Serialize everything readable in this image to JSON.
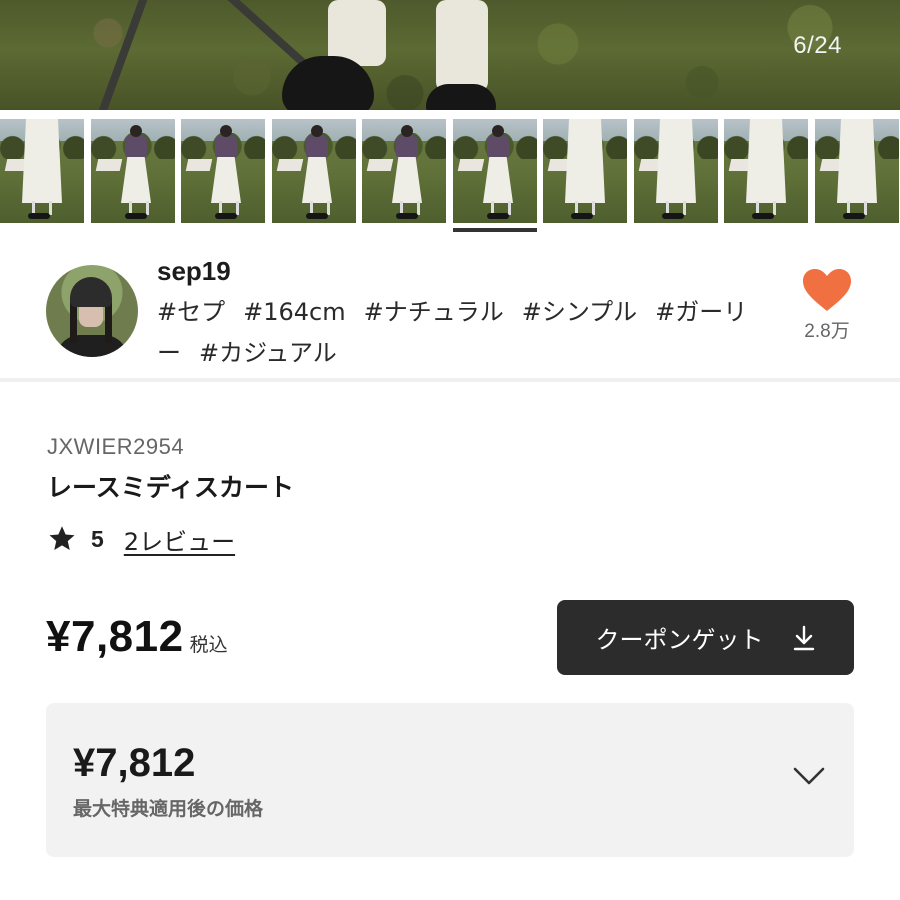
{
  "hero": {
    "image_counter": "6/24",
    "description_icon": "photo"
  },
  "thumbnails": {
    "count_visible": 10,
    "selected_index": 5,
    "items": [
      {
        "kind": "close"
      },
      {
        "kind": "full"
      },
      {
        "kind": "full"
      },
      {
        "kind": "full"
      },
      {
        "kind": "full"
      },
      {
        "kind": "full"
      },
      {
        "kind": "close"
      },
      {
        "kind": "close"
      },
      {
        "kind": "close"
      },
      {
        "kind": "close"
      }
    ]
  },
  "author": {
    "username": "sep19",
    "tags": [
      "#セプ",
      "#164cm",
      "#ナチュラル",
      "#シンプル",
      "#ガーリー",
      "#カジュアル"
    ],
    "likes": "2.8万",
    "heart_color": "#f07042"
  },
  "product": {
    "sku": "JXWIER2954",
    "title": "レースミディスカート",
    "rating_score": "5",
    "reviews_label": "2レビュー",
    "price": "¥7,812",
    "tax_label": "税込",
    "coupon_button_label": "クーポンゲット",
    "best_price": "¥7,812",
    "best_price_label": "最大特典適用後の価格"
  },
  "colors": {
    "button_bg": "#2c2c2c",
    "panel_bg": "#f2f2f2",
    "accent": "#f07042"
  }
}
